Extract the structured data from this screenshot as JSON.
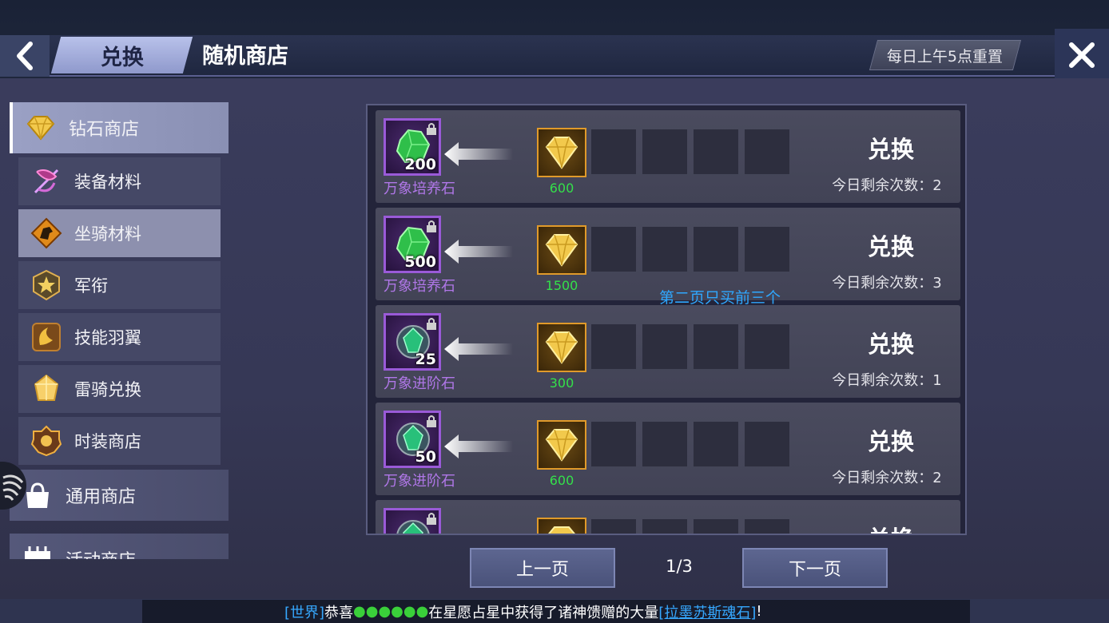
{
  "header": {
    "tab_exchange": "兑换",
    "title": "随机商店",
    "reset_notice": "每日上午5点重置"
  },
  "sidebar": {
    "items": [
      {
        "label": "钻石商店",
        "level": "main",
        "active": true,
        "icon": "diamond-icon"
      },
      {
        "label": "装备材料",
        "level": "sub",
        "active": false,
        "icon": "bow-icon"
      },
      {
        "label": "坐骑材料",
        "level": "sub",
        "active": true,
        "icon": "horse-icon"
      },
      {
        "label": "军衔",
        "level": "sub",
        "active": false,
        "icon": "rank-star-icon"
      },
      {
        "label": "技能羽翼",
        "level": "sub",
        "active": false,
        "icon": "wing-icon"
      },
      {
        "label": "雷骑兑换",
        "level": "sub",
        "active": false,
        "icon": "crystal-icon"
      },
      {
        "label": "时装商店",
        "level": "sub",
        "active": false,
        "icon": "fashion-badge-icon"
      },
      {
        "label": "通用商店",
        "level": "main",
        "active": false,
        "icon": "bag-icon"
      },
      {
        "label": "活动商店",
        "level": "main",
        "active": false,
        "icon": "calendar-icon"
      }
    ]
  },
  "shop": {
    "exchange_label": "兑换",
    "remain_prefix": "今日剩余次数：",
    "rows": [
      {
        "name": "万象培养石",
        "qty": "200",
        "cost": "600",
        "remain": "今日剩余次数：2",
        "gem": "green"
      },
      {
        "name": "万象培养石",
        "qty": "500",
        "cost": "1500",
        "remain": "今日剩余次数：3",
        "gem": "green"
      },
      {
        "name": "万象进阶石",
        "qty": "25",
        "cost": "300",
        "remain": "今日剩余次数：1",
        "gem": "teal"
      },
      {
        "name": "万象进阶石",
        "qty": "50",
        "cost": "600",
        "remain": "今日剩余次数：2",
        "gem": "teal"
      },
      {
        "name": "",
        "qty": "",
        "cost": "",
        "remain": "",
        "gem": "teal"
      }
    ],
    "note": "第二页只买前三个"
  },
  "pagination": {
    "prev": "上一页",
    "next": "下一页",
    "page": "1/3"
  },
  "chat": {
    "channel": "[世界]",
    "prefix": "恭喜",
    "masked_name": "●●●●●●",
    "middle": "在星愿占星中获得了诸神馈赠的大量",
    "item": "[拉墨苏斯魂石]",
    "suffix": "!"
  },
  "colors": {
    "accent_purple": "#9a5ad8",
    "cost_green": "#34e04a",
    "note_blue": "#2fa8ff",
    "gold_border": "#e09a2a"
  }
}
